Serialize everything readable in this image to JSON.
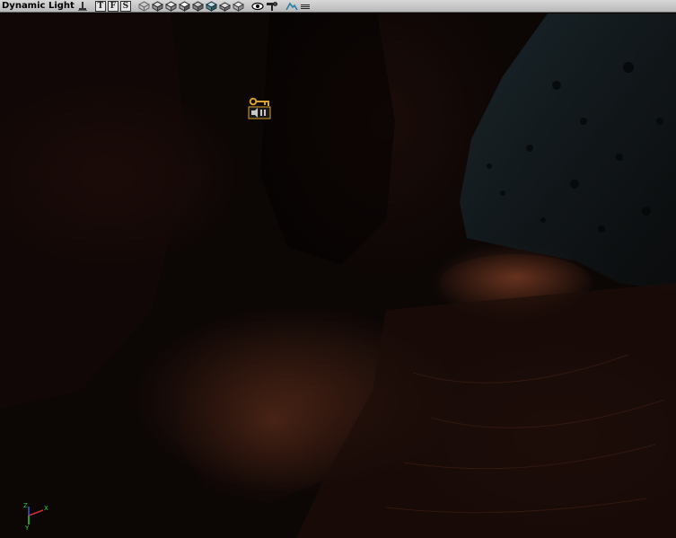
{
  "toolbar": {
    "title": "Dynamic Light",
    "buttons": [
      {
        "name": "actor-pin-icon"
      },
      {
        "name": "top-view-button",
        "label": "T"
      },
      {
        "name": "front-view-button",
        "label": "F"
      },
      {
        "name": "side-view-button",
        "label": "S"
      },
      {
        "name": "perspective-wire-icon"
      },
      {
        "name": "render-mode-1-icon"
      },
      {
        "name": "render-mode-2-icon"
      },
      {
        "name": "render-mode-3-icon"
      },
      {
        "name": "render-mode-4-icon"
      },
      {
        "name": "render-mode-5-icon"
      },
      {
        "name": "render-mode-6-icon"
      },
      {
        "name": "render-mode-7-icon"
      },
      {
        "name": "show-flags-eye-icon"
      },
      {
        "name": "lock-pin-icon"
      },
      {
        "name": "terrain-mountain-icon"
      },
      {
        "name": "viewport-menu-icon"
      }
    ]
  },
  "viewport": {
    "gizmo_labels": {
      "z": "Z",
      "x": "X",
      "y": "Y"
    },
    "colors": {
      "rock_dark": "#0c0605",
      "rock_lit": "#5a2c1a",
      "wall_blue": "#142024",
      "key_gold": "#d8a030",
      "gizmo_green": "#30d030",
      "gizmo_red": "#d03030"
    }
  }
}
